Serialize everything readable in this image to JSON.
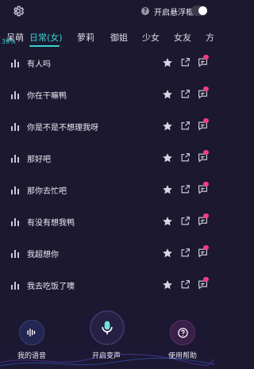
{
  "header": {
    "gear_icon": "gear-icon",
    "help_icon": "help-icon",
    "floating_window_label": "开启悬浮框",
    "floating_window_enabled": false
  },
  "tabs": [
    "呆萌",
    "日常(女)",
    "萝莉",
    "御姐",
    "少女",
    "女友",
    "方"
  ],
  "active_tab": "日常(女)",
  "progress_label": "39%",
  "phrases": [
    "有人吗",
    "你在干嘛鸭",
    "你是不是不想理我呀",
    "那好吧",
    "那你去忙吧",
    "有没有想我鸭",
    "我超想你",
    "我去吃饭了噢"
  ],
  "bottom_nav": {
    "my_voice": "我的语音",
    "start_voice_change": "开启变声",
    "help": "使用帮助"
  },
  "colors": {
    "background": "#1b1830",
    "accent": "#35d4cc",
    "badge": "#ee3d86"
  }
}
